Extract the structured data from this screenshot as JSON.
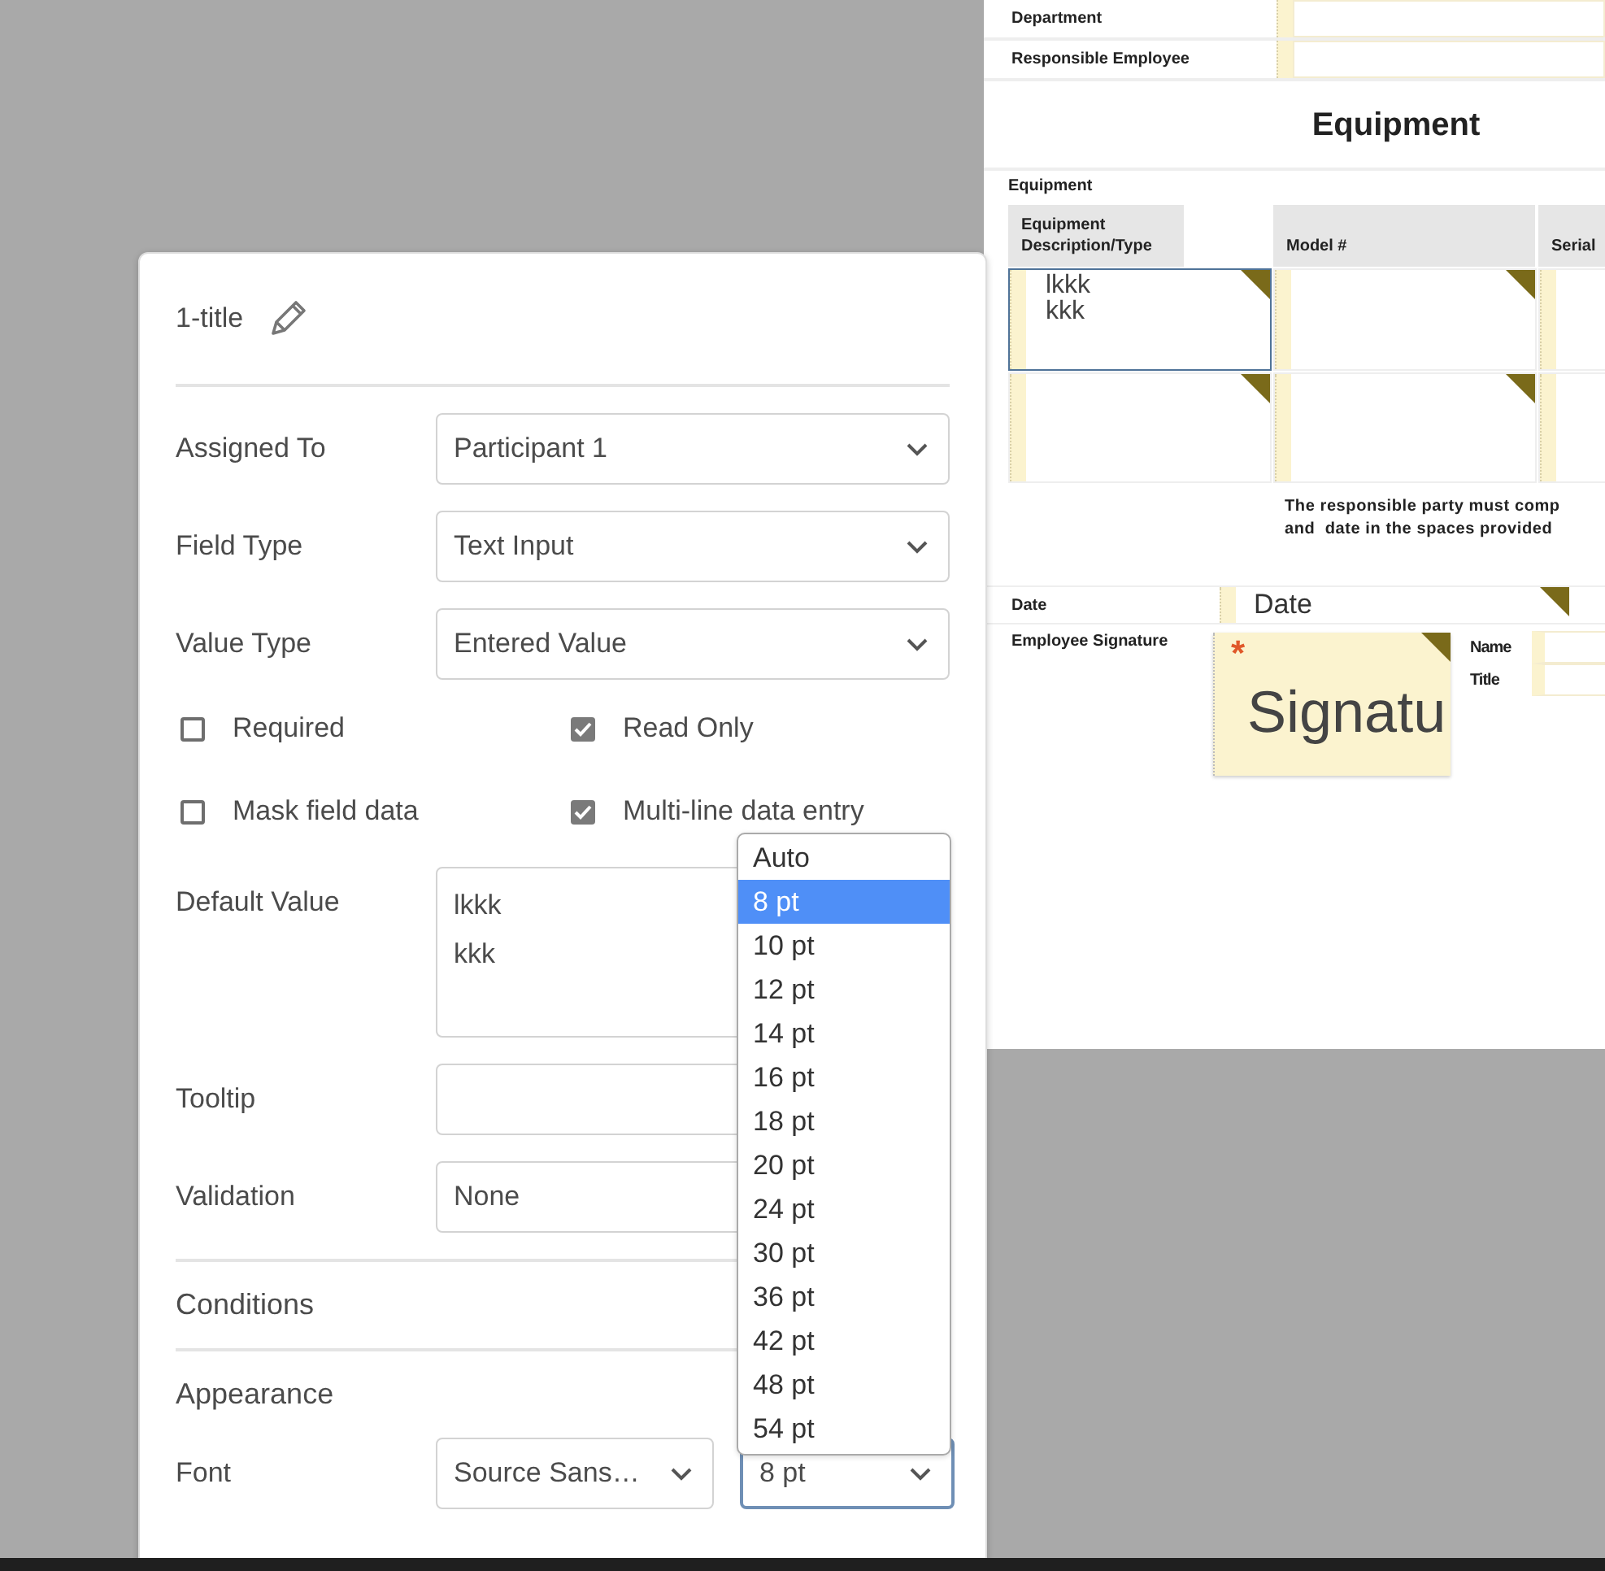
{
  "document": {
    "rows": [
      {
        "label": "Department"
      },
      {
        "label": "Responsible Employee"
      }
    ],
    "heading": "Equipment",
    "section_label": "Equipment",
    "table": {
      "columns": [
        "Equipment Description/Type",
        "Model #",
        "Serial"
      ],
      "rows": [
        [
          {
            "value": "lkkk\nkkk",
            "selected": true
          },
          {
            "selected": false
          },
          {
            "selected": false
          }
        ],
        [
          {
            "selected": false
          },
          {
            "selected": false
          },
          {
            "selected": false
          }
        ]
      ]
    },
    "note": [
      "The responsible party must comp",
      "and  date in the spaces provided"
    ],
    "date": {
      "label": "Date",
      "placeholder": "Date"
    },
    "signature": {
      "label": "Employee Signature",
      "placeholder": "Signatu",
      "required_mark": "*"
    },
    "side_fields": [
      {
        "label": "Name"
      },
      {
        "label": "Title"
      }
    ]
  },
  "panel": {
    "title": "1-title",
    "selects": [
      {
        "label": "Assigned To",
        "value": "Participant 1"
      },
      {
        "label": "Field Type",
        "value": "Text Input"
      },
      {
        "label": "Value Type",
        "value": "Entered Value"
      }
    ],
    "checkboxes": [
      {
        "label": "Required",
        "checked": false
      },
      {
        "label": "Read Only",
        "checked": true
      },
      {
        "label": "Mask field data",
        "checked": false
      },
      {
        "label": "Multi-line data entry",
        "checked": true
      }
    ],
    "default_value": {
      "label": "Default Value",
      "value": "lkkk\nkkk"
    },
    "tooltip": {
      "label": "Tooltip"
    },
    "validation": {
      "label": "Validation",
      "value": "None"
    },
    "sections": [
      "Conditions",
      "Appearance"
    ],
    "font": {
      "label": "Font",
      "family": "Source Sans…",
      "size": "8 pt",
      "size_open": true
    },
    "size_options": [
      {
        "label": "Auto",
        "selected": false
      },
      {
        "label": "8 pt",
        "selected": true
      },
      {
        "label": "10 pt",
        "selected": false
      },
      {
        "label": "12 pt",
        "selected": false
      },
      {
        "label": "14 pt",
        "selected": false
      },
      {
        "label": "16 pt",
        "selected": false
      },
      {
        "label": "18 pt",
        "selected": false
      },
      {
        "label": "20 pt",
        "selected": false
      },
      {
        "label": "24 pt",
        "selected": false
      },
      {
        "label": "30 pt",
        "selected": false
      },
      {
        "label": "36 pt",
        "selected": false
      },
      {
        "label": "42 pt",
        "selected": false
      },
      {
        "label": "48 pt",
        "selected": false
      },
      {
        "label": "54 pt",
        "selected": false
      }
    ]
  }
}
